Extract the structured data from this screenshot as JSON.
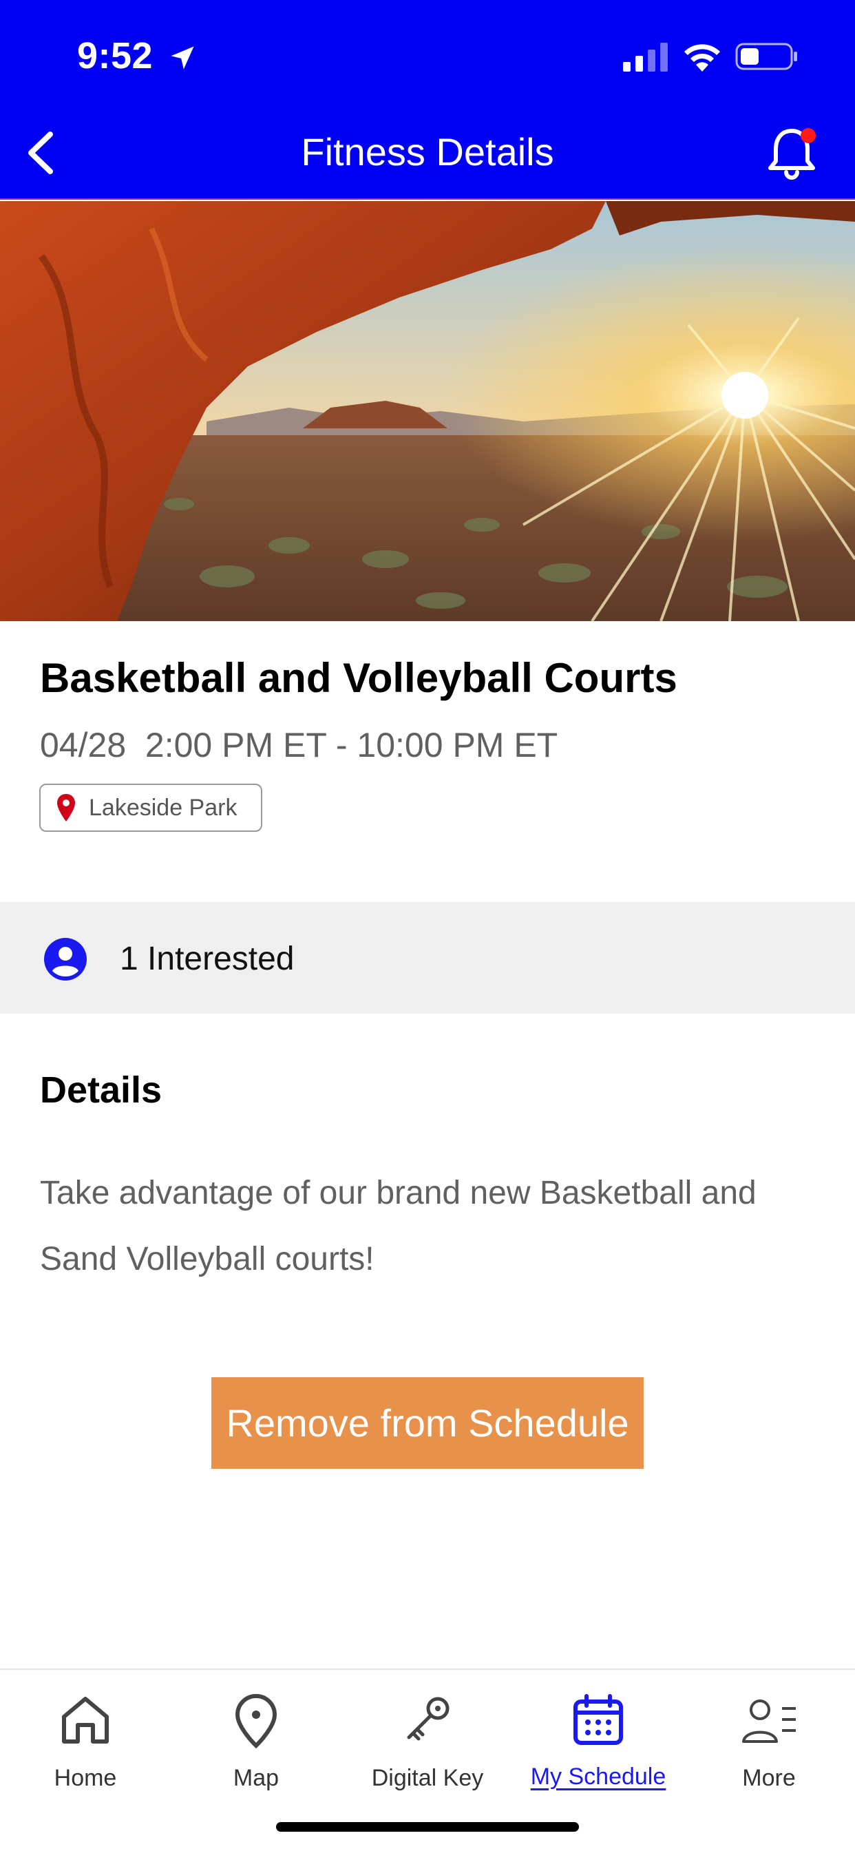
{
  "status_bar": {
    "time": "9:52"
  },
  "header": {
    "title": "Fitness Details",
    "back_icon": "chevron-left-icon",
    "bell_icon": "bell-icon",
    "has_notification": true
  },
  "event": {
    "title": "Basketball and Volleyball Courts",
    "datetime": "04/28  2:00 PM ET - 10:00 PM ET",
    "location": "Lakeside Park"
  },
  "interest": {
    "label": "1 Interested"
  },
  "details": {
    "heading": "Details",
    "body": "Take advantage of our brand new Basketball and Sand Volleyball courts!"
  },
  "actions": {
    "remove_label": "Remove from Schedule"
  },
  "tabbar": {
    "items": [
      {
        "label": "Home",
        "icon": "home-icon",
        "active": false
      },
      {
        "label": "Map",
        "icon": "map-pin-icon",
        "active": false
      },
      {
        "label": "Digital Key",
        "icon": "key-icon",
        "active": false
      },
      {
        "label": "My Schedule",
        "icon": "calendar-icon",
        "active": true
      },
      {
        "label": "More",
        "icon": "profile-menu-icon",
        "active": false
      }
    ]
  },
  "colors": {
    "header_bg": "#0000F5",
    "accent_orange": "#E8914A",
    "active_tab": "#1a1af0",
    "pin_red": "#d0021b"
  }
}
